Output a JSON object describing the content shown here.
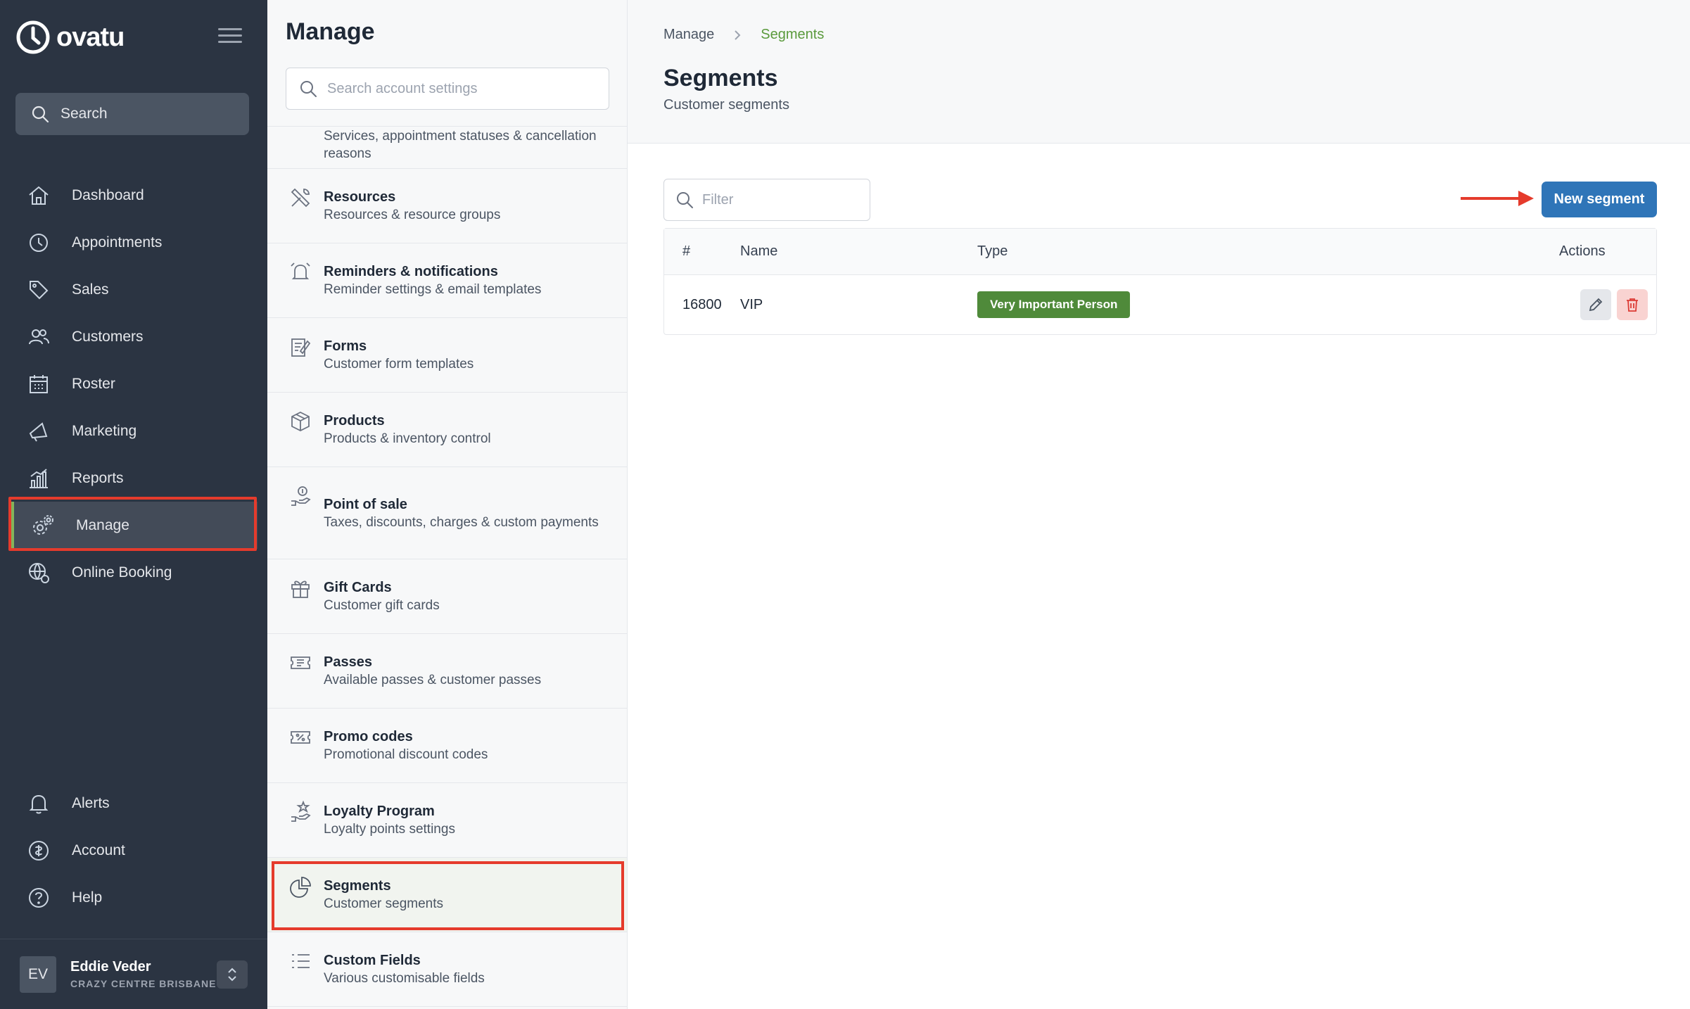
{
  "brand": {
    "name": "ovatu"
  },
  "sidebar": {
    "search_label": "Search",
    "items": [
      {
        "label": "Dashboard",
        "icon": "home-icon"
      },
      {
        "label": "Appointments",
        "icon": "clock-icon"
      },
      {
        "label": "Sales",
        "icon": "tag-icon"
      },
      {
        "label": "Customers",
        "icon": "users-icon"
      },
      {
        "label": "Roster",
        "icon": "calendar-icon"
      },
      {
        "label": "Marketing",
        "icon": "megaphone-icon"
      },
      {
        "label": "Reports",
        "icon": "chart-icon"
      },
      {
        "label": "Manage",
        "icon": "gears-icon",
        "active": true
      },
      {
        "label": "Online Booking",
        "icon": "globe-gear-icon"
      }
    ],
    "bottom_items": [
      {
        "label": "Alerts",
        "icon": "bell-icon"
      },
      {
        "label": "Account",
        "icon": "account-icon"
      },
      {
        "label": "Help",
        "icon": "help-icon"
      }
    ],
    "user": {
      "initials": "EV",
      "name": "Eddie Veder",
      "org": "CRAZY CENTRE BRISBANE"
    }
  },
  "manage_panel": {
    "title": "Manage",
    "search_placeholder": "Search account settings",
    "items": [
      {
        "title": "",
        "desc": "Services, appointment statuses & cancellation reasons"
      },
      {
        "title": "Resources",
        "desc": "Resources & resource groups"
      },
      {
        "title": "Reminders & notifications",
        "desc": "Reminder settings & email templates"
      },
      {
        "title": "Forms",
        "desc": "Customer form templates"
      },
      {
        "title": "Products",
        "desc": "Products & inventory control"
      },
      {
        "title": "Point of sale",
        "desc": "Taxes, discounts, charges & custom payments"
      },
      {
        "title": "Gift Cards",
        "desc": "Customer gift cards"
      },
      {
        "title": "Passes",
        "desc": "Available passes & customer passes"
      },
      {
        "title": "Promo codes",
        "desc": "Promotional discount codes"
      },
      {
        "title": "Loyalty Program",
        "desc": "Loyalty points settings"
      },
      {
        "title": "Segments",
        "desc": "Customer segments"
      },
      {
        "title": "Custom Fields",
        "desc": "Various customisable fields"
      }
    ]
  },
  "main": {
    "breadcrumb": {
      "parent": "Manage",
      "current": "Segments"
    },
    "title": "Segments",
    "subtitle": "Customer segments",
    "filter_placeholder": "Filter",
    "new_button": "New segment",
    "table": {
      "headers": {
        "num": "#",
        "name": "Name",
        "type": "Type",
        "actions": "Actions"
      },
      "rows": [
        {
          "num": "16800",
          "name": "VIP",
          "type": "Very Important Person"
        }
      ]
    }
  },
  "colors": {
    "sidebar_bg": "#2b3442",
    "accent_green": "#5a9a3c",
    "badge_green": "#4f8a3a",
    "primary_blue": "#2f75b8",
    "highlight_red": "#e53b2c"
  }
}
